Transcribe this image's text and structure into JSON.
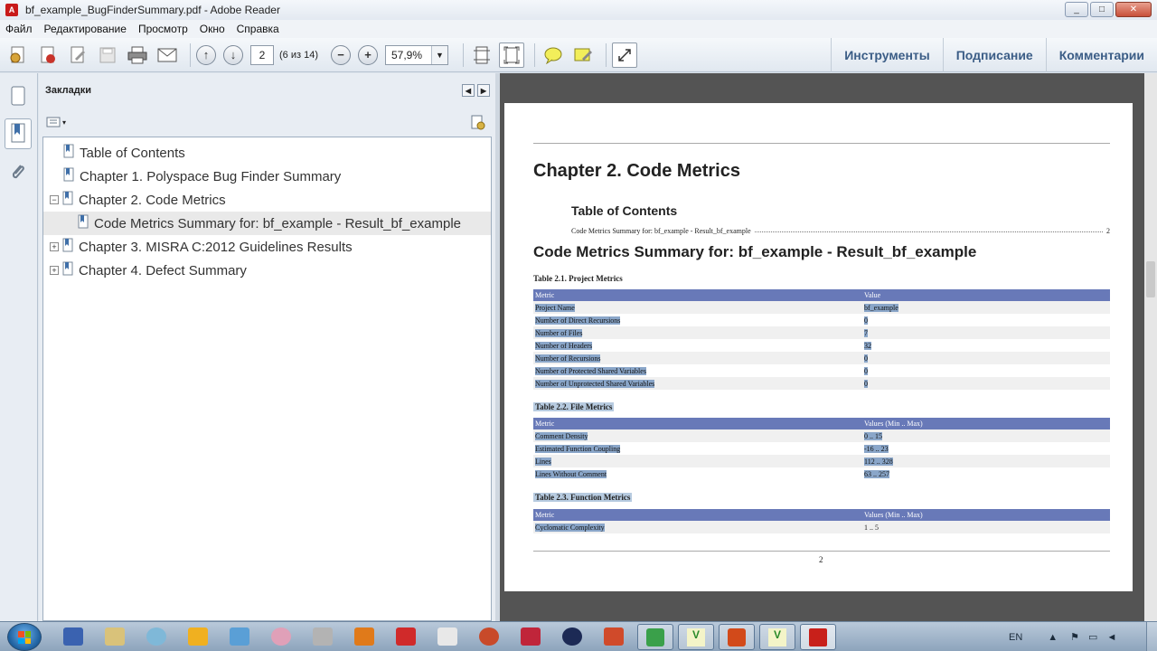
{
  "window": {
    "title": "bf_example_BugFinderSummary.pdf - Adobe Reader",
    "controls": [
      "_",
      "□",
      "✕"
    ]
  },
  "menu": [
    "Файл",
    "Редактирование",
    "Просмотр",
    "Окно",
    "Справка"
  ],
  "toolbar": {
    "page_number": "2",
    "page_count": "(6 из 14)",
    "zoom": "57,9%",
    "right_links": [
      "Инструменты",
      "Подписание",
      "Комментарии"
    ]
  },
  "bookmarks": {
    "header": "Закладки",
    "items": [
      {
        "label": "Table of Contents",
        "expander": ""
      },
      {
        "label": "Chapter 1. Polyspace Bug Finder Summary",
        "expander": ""
      },
      {
        "label": "Chapter 2. Code Metrics",
        "expander": "−"
      },
      {
        "label": "Code Metrics Summary for: bf_example - Result_bf_example",
        "expander": ""
      },
      {
        "label": "Chapter 3. MISRA C:2012 Guidelines Results",
        "expander": "+"
      },
      {
        "label": "Chapter 4. Defect Summary",
        "expander": "+"
      }
    ]
  },
  "document": {
    "chapter_title": "Chapter 2. Code Metrics",
    "toc_title": "Table of Contents",
    "toc_entry": "Code Metrics Summary for: bf_example - Result_bf_example",
    "toc_page": "2",
    "section_title": "Code Metrics Summary for: bf_example - Result_bf_example",
    "table1": {
      "caption": "Table 2.1. Project Metrics",
      "headers": [
        "Metric",
        "Value"
      ],
      "rows": [
        [
          "Project Name",
          "bf_example"
        ],
        [
          "Number of Direct Recursions",
          "0"
        ],
        [
          "Number of Files",
          "7"
        ],
        [
          "Number of Headers",
          "32"
        ],
        [
          "Number of Recursions",
          "0"
        ],
        [
          "Number of Protected Shared Variables",
          "0"
        ],
        [
          "Number of Unprotected Shared Variables",
          "0"
        ]
      ]
    },
    "table2": {
      "caption": "Table 2.2. File Metrics",
      "headers": [
        "Metric",
        "Values (Min .. Max)"
      ],
      "rows": [
        [
          "Comment Density",
          "0 .. 15"
        ],
        [
          "Estimated Function Coupling",
          "-16 .. 23"
        ],
        [
          "Lines",
          "112 .. 328"
        ],
        [
          "Lines Without Comment",
          "63 .. 257"
        ]
      ]
    },
    "table3": {
      "caption": "Table 2.3. Function Metrics",
      "headers": [
        "Metric",
        "Values (Min .. Max)"
      ],
      "rows": [
        [
          "Cyclomatic Complexity",
          "1 .. 5"
        ]
      ]
    },
    "page_number": "2"
  },
  "taskbar": {
    "language": "EN"
  }
}
